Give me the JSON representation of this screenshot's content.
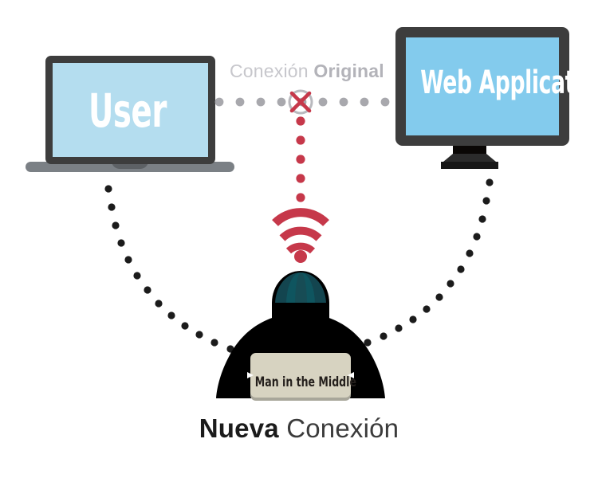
{
  "diagram": {
    "title_alt": "Man in the Middle attack diagram",
    "nodes": {
      "user": {
        "label": "User",
        "device": "laptop",
        "screen_color": "#b4ddef",
        "bezel_color": "#3d3d3d",
        "base_color": "#7b8085"
      },
      "web_application": {
        "label": "Web Application",
        "device": "desktop-monitor",
        "screen_color": "#83cbed",
        "bezel_color": "#3d3d3d",
        "stand_color": "#2b2b2b"
      },
      "attacker": {
        "laptop_label": "Man in the Middle",
        "beanie_color": "#13454f",
        "beanie_panel_color": "#0f555f",
        "body_color": "#000000",
        "laptop_color": "#d7d3c1",
        "laptop_shadow_color": "#a8a69a"
      }
    },
    "connections": {
      "original": {
        "label_plain": "Conexión ",
        "label_bold": "Original",
        "style": "dotted",
        "dot_color": "#a8a8ad",
        "state": "blocked",
        "blocked_marker": "x-mark",
        "blocked_marker_color": "#c6384a"
      },
      "new": {
        "label_plain": " Conexión",
        "label_bold": "Nueva",
        "style": "dotted",
        "dot_color": "#1b1b1b"
      },
      "intercept": {
        "style": "dotted-vertical",
        "dot_color": "#c6384a"
      }
    },
    "icons": {
      "wifi": {
        "name": "wifi-icon",
        "color": "#c6384a",
        "arcs": 3
      },
      "block": {
        "name": "x-mark-icon",
        "color": "#c6384a",
        "ring_color": "#b9b9be"
      }
    }
  }
}
